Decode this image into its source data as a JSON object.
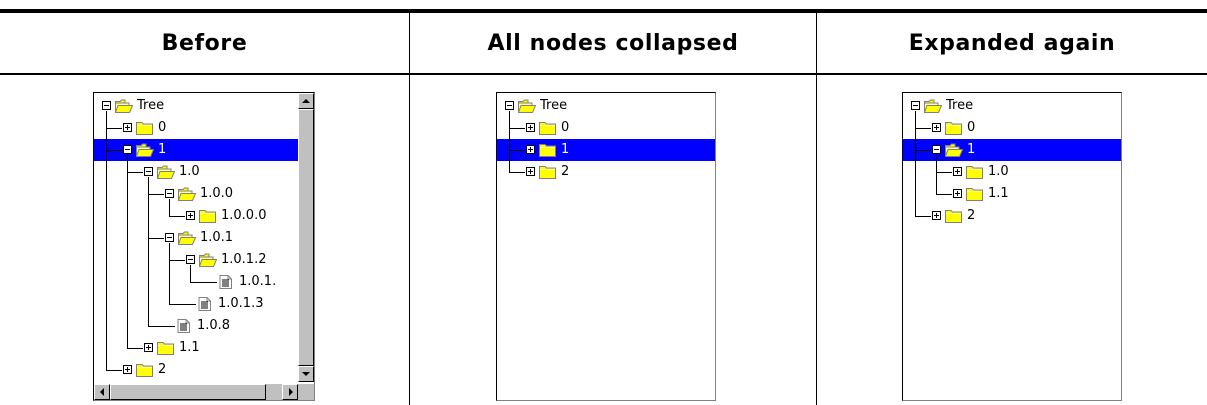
{
  "headers": [
    "Before",
    "All nodes collapsed",
    "Expanded again"
  ],
  "colors": {
    "selection": "#0000ff",
    "folder": "#ffff00",
    "scrollbar": "#c0c0c0"
  },
  "panels": [
    {
      "name": "before",
      "rows": [
        {
          "label": "Tree",
          "depth": 0,
          "icon": "folder-open",
          "pm": "minus"
        },
        {
          "label": "0",
          "depth": 1,
          "icon": "folder",
          "pm": "plus"
        },
        {
          "label": "1",
          "depth": 1,
          "icon": "folder-open",
          "pm": "minus",
          "selected": true
        },
        {
          "label": "1.0",
          "depth": 2,
          "icon": "folder-open",
          "pm": "minus"
        },
        {
          "label": "1.0.0",
          "depth": 3,
          "icon": "folder-open",
          "pm": "minus"
        },
        {
          "label": "1.0.0.0",
          "depth": 4,
          "icon": "folder",
          "pm": "plus"
        },
        {
          "label": "1.0.1",
          "depth": 3,
          "icon": "folder-open",
          "pm": "minus"
        },
        {
          "label": "1.0.1.2",
          "depth": 4,
          "icon": "folder-open",
          "pm": "minus"
        },
        {
          "label": "1.0.1.",
          "depth": 5,
          "icon": "document",
          "pm": "none"
        },
        {
          "label": "1.0.1.3",
          "depth": 4,
          "icon": "document",
          "pm": "none"
        },
        {
          "label": "1.0.8",
          "depth": 3,
          "icon": "document",
          "pm": "none"
        },
        {
          "label": "1.1",
          "depth": 2,
          "icon": "folder",
          "pm": "plus"
        },
        {
          "label": "2",
          "depth": 1,
          "icon": "folder",
          "pm": "plus"
        }
      ]
    },
    {
      "name": "collapsed",
      "rows": [
        {
          "label": "Tree",
          "depth": 0,
          "icon": "folder-open",
          "pm": "minus"
        },
        {
          "label": "0",
          "depth": 1,
          "icon": "folder",
          "pm": "plus"
        },
        {
          "label": "1",
          "depth": 1,
          "icon": "folder",
          "pm": "plus",
          "selected": true
        },
        {
          "label": "2",
          "depth": 1,
          "icon": "folder",
          "pm": "plus"
        }
      ]
    },
    {
      "name": "expanded",
      "rows": [
        {
          "label": "Tree",
          "depth": 0,
          "icon": "folder-open",
          "pm": "minus"
        },
        {
          "label": "0",
          "depth": 1,
          "icon": "folder",
          "pm": "plus"
        },
        {
          "label": "1",
          "depth": 1,
          "icon": "folder-open",
          "pm": "minus",
          "selected": true
        },
        {
          "label": "1.0",
          "depth": 2,
          "icon": "folder",
          "pm": "plus"
        },
        {
          "label": "1.1",
          "depth": 2,
          "icon": "folder",
          "pm": "plus"
        },
        {
          "label": "2",
          "depth": 1,
          "icon": "folder",
          "pm": "plus"
        }
      ]
    }
  ]
}
